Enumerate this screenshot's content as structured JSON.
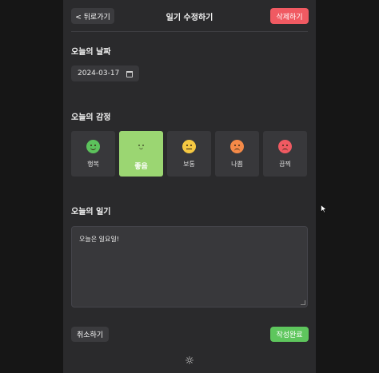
{
  "header": {
    "back_label": "< 뒤로가기",
    "title": "일기 수정하기",
    "delete_label": "삭제하기"
  },
  "date_section": {
    "title": "오늘의 날짜",
    "value": "2024-03-17"
  },
  "emotion_section": {
    "title": "오늘의 감정",
    "items": [
      {
        "label": "행복",
        "color": "#5cc25c",
        "mood": "happy"
      },
      {
        "label": "좋음",
        "color": "#9bd672",
        "mood": "good"
      },
      {
        "label": "보통",
        "color": "#f5c842",
        "mood": "neutral"
      },
      {
        "label": "나쁨",
        "color": "#f58a48",
        "mood": "bad"
      },
      {
        "label": "끔찍",
        "color": "#f05a62",
        "mood": "awful"
      }
    ],
    "selected_index": 1
  },
  "diary_section": {
    "title": "오늘의 일기",
    "content": "오늘은 일요일!"
  },
  "footer": {
    "cancel_label": "취소하기",
    "submit_label": "작성완료"
  },
  "colors": {
    "accent_green": "#5ec65d",
    "danger_red": "#f05a62",
    "panel_bg": "#2a2a2c",
    "page_bg": "#161616"
  },
  "icons": {
    "theme_toggle": "sun-icon",
    "date_picker": "calendar-icon"
  }
}
